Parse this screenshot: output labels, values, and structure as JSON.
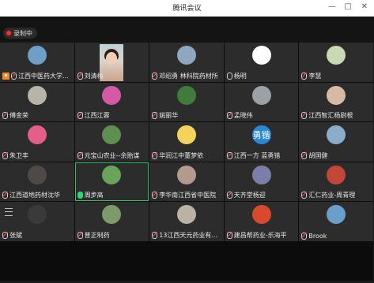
{
  "window": {
    "title": "腾讯会议"
  },
  "recording": {
    "label": "录制中",
    "color": "#e53935"
  },
  "participants": [
    {
      "name": "江西中医药大学...",
      "mic": "muted",
      "host": true,
      "avatar": "#6f9fc4",
      "icon": "avatar-photo-icon"
    },
    {
      "name": "刘清梅",
      "mic": "muted",
      "video": true,
      "icon": "camera-video-icon"
    },
    {
      "name": "邓绍勇 林科院药材所",
      "mic": "muted",
      "avatar": "#8da7bf",
      "icon": "tree-avatar-icon"
    },
    {
      "name": "杨明",
      "mic": "on",
      "avatar": "#ffffff",
      "icon": "calligraphy-avatar-icon"
    },
    {
      "name": "李慧",
      "mic": "muted",
      "avatar": "#c9d9b3",
      "icon": "flower-avatar-icon"
    },
    {
      "name": "傅金荣",
      "mic": "muted",
      "avatar": "#b9b4a8",
      "icon": "building-avatar-icon"
    },
    {
      "name": "江西江蓉",
      "mic": "muted",
      "avatar": "#d45aa6",
      "icon": "flower-avatar-icon"
    },
    {
      "name": "姚丽华",
      "mic": "muted",
      "avatar": "#3f7b3a",
      "icon": "plant-avatar-icon"
    },
    {
      "name": "孟晓伟",
      "mic": "muted",
      "avatar": "#9aa2a8",
      "icon": "landscape-avatar-icon"
    },
    {
      "name": "江西智汇杨尉根",
      "mic": "muted",
      "avatar": "#d7b9a5",
      "icon": "person-avatar-icon"
    },
    {
      "name": "朱卫丰",
      "mic": "muted",
      "avatar": "#e25f8a",
      "icon": "flower-avatar-icon"
    },
    {
      "name": "元宝山农业--余贻谋",
      "mic": "muted",
      "avatar": "#5f8f4f",
      "icon": "field-avatar-icon"
    },
    {
      "name": "华润江中董梦依",
      "mic": "muted",
      "avatar": "#f3d35b",
      "icon": "cartoon-avatar-icon"
    },
    {
      "name": "江西一方 蓝勇锴",
      "mic": "muted",
      "avatar": "#2b88d8",
      "text": "勇锴",
      "icon": "text-avatar-icon"
    },
    {
      "name": "胡国健",
      "mic": "muted",
      "avatar": "#88aecb",
      "icon": "landscape-avatar-icon"
    },
    {
      "name": "江西道地药材沈华",
      "mic": "muted",
      "avatar": "#4f4a47",
      "icon": "person-avatar-icon"
    },
    {
      "name": "周步高",
      "mic": "speaking",
      "active": true,
      "avatar": "#6aa35a",
      "icon": "field-avatar-icon"
    },
    {
      "name": "李华南江西省中医院",
      "mic": "muted",
      "avatar": "#b39a8e",
      "icon": "person-avatar-icon"
    },
    {
      "name": "天齐堂杨迎",
      "mic": "muted",
      "avatar": "#7b7fa8",
      "icon": "sky-avatar-icon"
    },
    {
      "name": "汇仁药业-周青理",
      "mic": "muted",
      "avatar": "#c34638",
      "icon": "building-avatar-icon"
    },
    {
      "name": "张斌",
      "mic": "muted",
      "menu": true,
      "avatar": "#3a3a3a",
      "icon": "person-avatar-icon"
    },
    {
      "name": "普正制药",
      "mic": "muted",
      "avatar": "#7d9a6a",
      "icon": "building-avatar-icon"
    },
    {
      "name": "13江西天元药业有...",
      "mic": "muted",
      "avatar": "#b9b2a5",
      "icon": "building-avatar-icon"
    },
    {
      "name": "建昌帮药业-乐海平",
      "mic": "muted",
      "avatar": "#d84a2b",
      "icon": "logo-avatar-icon"
    },
    {
      "name": "Brook",
      "mic": "muted",
      "avatar": "#6b9fca",
      "icon": "landscape-avatar-icon"
    }
  ]
}
